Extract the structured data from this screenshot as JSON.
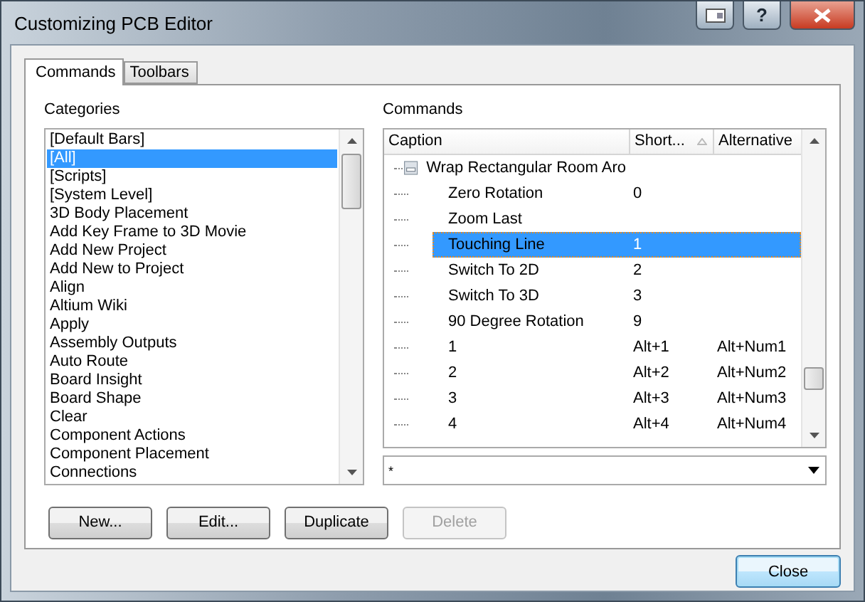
{
  "window": {
    "title": "Customizing PCB Editor",
    "help_button": "?"
  },
  "tabs": [
    {
      "label": "Commands",
      "selected": true
    },
    {
      "label": "Toolbars",
      "selected": false
    }
  ],
  "categories": {
    "label": "Categories",
    "items": [
      {
        "text": "[Default Bars]",
        "selected": false
      },
      {
        "text": "[All]",
        "selected": true
      },
      {
        "text": "[Scripts]",
        "selected": false
      },
      {
        "text": "[System Level]",
        "selected": false
      },
      {
        "text": "3D Body Placement",
        "selected": false
      },
      {
        "text": "Add Key Frame to 3D Movie",
        "selected": false
      },
      {
        "text": "Add New Project",
        "selected": false
      },
      {
        "text": "Add New to Project",
        "selected": false
      },
      {
        "text": "Align",
        "selected": false
      },
      {
        "text": "Altium Wiki",
        "selected": false
      },
      {
        "text": "Apply",
        "selected": false
      },
      {
        "text": "Assembly Outputs",
        "selected": false
      },
      {
        "text": "Auto Route",
        "selected": false
      },
      {
        "text": "Board Insight",
        "selected": false
      },
      {
        "text": "Board Shape",
        "selected": false
      },
      {
        "text": "Clear",
        "selected": false
      },
      {
        "text": "Component Actions",
        "selected": false
      },
      {
        "text": "Component Placement",
        "selected": false
      },
      {
        "text": "Connections",
        "selected": false
      }
    ]
  },
  "commands": {
    "label": "Commands",
    "columns": [
      {
        "title": "Caption",
        "sorted": false
      },
      {
        "title": "Short...",
        "sorted": true
      },
      {
        "title": "Alternative",
        "sorted": false
      }
    ],
    "rows": [
      {
        "caption": "Wrap Rectangular Room Aro",
        "shortcut": "",
        "alternative": "",
        "has_icon": true,
        "selected": false
      },
      {
        "caption": "Zero Rotation",
        "shortcut": "0",
        "alternative": "",
        "has_icon": false,
        "selected": false
      },
      {
        "caption": "Zoom Last",
        "shortcut": "",
        "alternative": "",
        "has_icon": false,
        "selected": false
      },
      {
        "caption": "Touching Line",
        "shortcut": "1",
        "alternative": "",
        "has_icon": false,
        "selected": true
      },
      {
        "caption": "Switch To 2D",
        "shortcut": "2",
        "alternative": "",
        "has_icon": false,
        "selected": false
      },
      {
        "caption": "Switch To 3D",
        "shortcut": "3",
        "alternative": "",
        "has_icon": false,
        "selected": false
      },
      {
        "caption": "90 Degree Rotation",
        "shortcut": "9",
        "alternative": "",
        "has_icon": false,
        "selected": false
      },
      {
        "caption": "1",
        "shortcut": "Alt+1",
        "alternative": "Alt+Num1",
        "has_icon": false,
        "selected": false
      },
      {
        "caption": "2",
        "shortcut": "Alt+2",
        "alternative": "Alt+Num2",
        "has_icon": false,
        "selected": false
      },
      {
        "caption": "3",
        "shortcut": "Alt+3",
        "alternative": "Alt+Num3",
        "has_icon": false,
        "selected": false
      },
      {
        "caption": "4",
        "shortcut": "Alt+4",
        "alternative": "Alt+Num4",
        "has_icon": false,
        "selected": false
      }
    ],
    "filter": {
      "value": "*"
    }
  },
  "buttons": [
    {
      "label": "New...",
      "disabled": false
    },
    {
      "label": "Edit...",
      "disabled": false
    },
    {
      "label": "Duplicate",
      "disabled": false
    },
    {
      "label": "Delete",
      "disabled": true
    }
  ],
  "close_button": "Close"
}
